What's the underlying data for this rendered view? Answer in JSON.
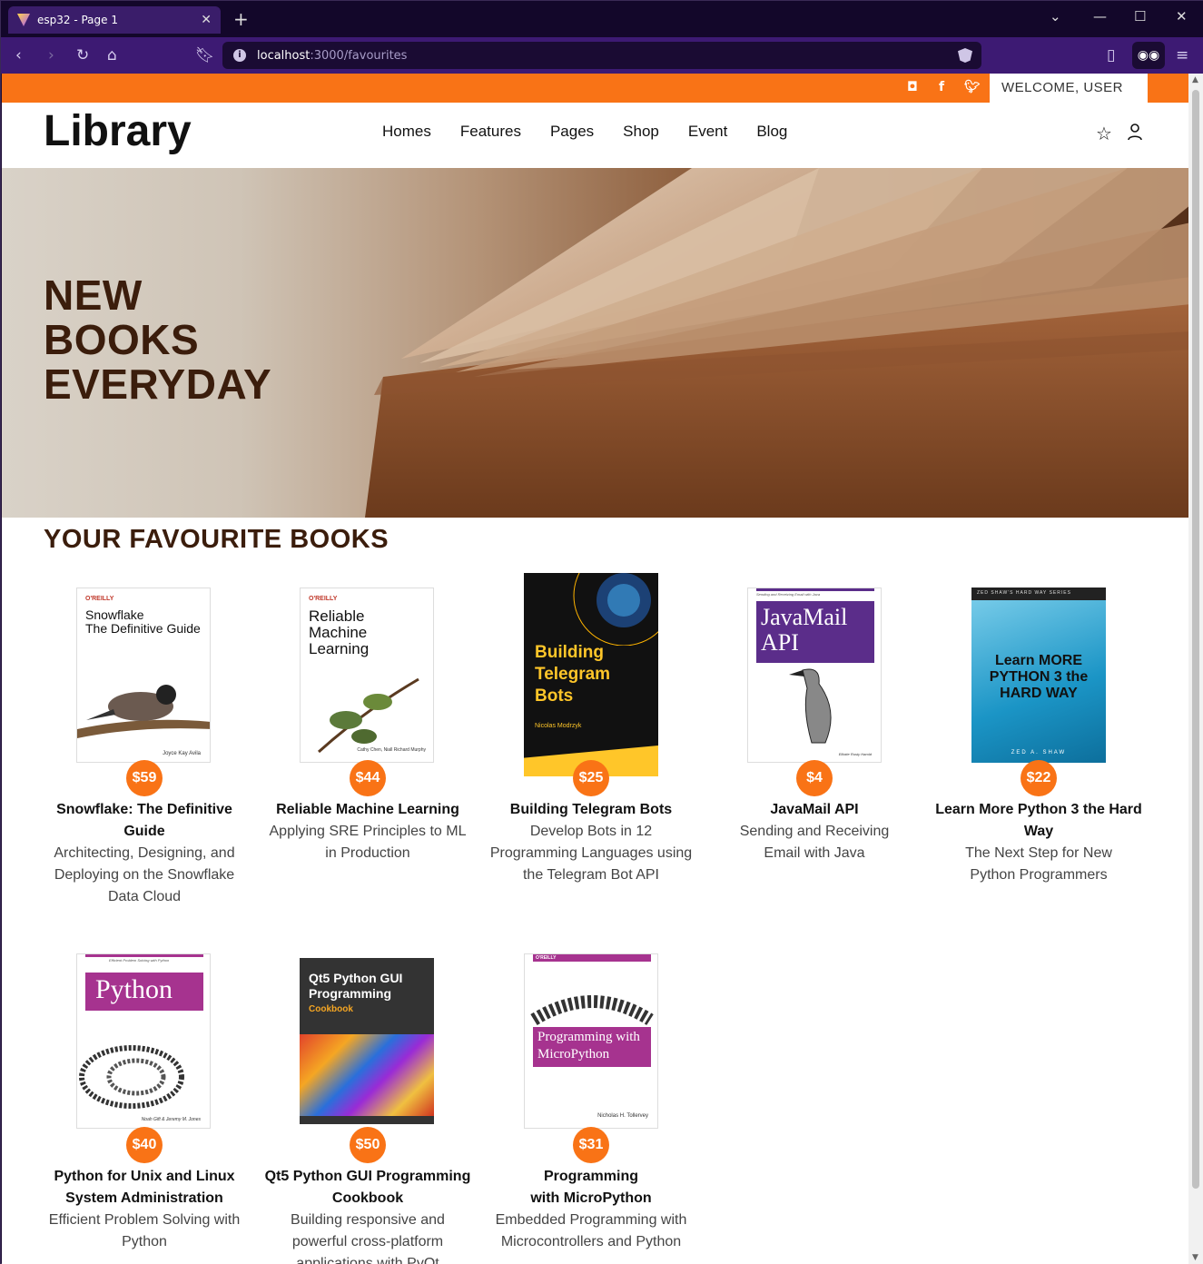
{
  "browser": {
    "tab_title": "esp32 - Page 1",
    "url_host": "localhost",
    "url_path": ":3000/favourites"
  },
  "topbar": {
    "welcome": "WELCOME, USER",
    "social": [
      "instagram-icon",
      "facebook-icon",
      "twitter-icon"
    ]
  },
  "header": {
    "logo": "Library",
    "nav": [
      "Homes",
      "Features",
      "Pages",
      "Shop",
      "Event",
      "Blog"
    ]
  },
  "hero": {
    "line1": "NEW",
    "line2": "BOOKS",
    "line3": "EVERYDAY"
  },
  "section_title": "YOUR FAVOURITE BOOKS",
  "books": [
    {
      "price": "$59",
      "title": "Snowflake: The Definitive Guide",
      "subtitle": "Architecting, Designing, and Deploying on the Snowflake Data Cloud",
      "cover_top": "O'REILLY",
      "cover_title": "Snowflake\nThe Definitive Guide",
      "cover_author": "Joyce Kay Avila"
    },
    {
      "price": "$44",
      "title": "Reliable Machine Learning",
      "subtitle": "Applying SRE Principles to ML in Production",
      "cover_top": "O'REILLY",
      "cover_title": "Reliable Machine Learning",
      "cover_author": "Cathy Chen, Niall Richard Murphy"
    },
    {
      "price": "$25",
      "title": "Building Telegram Bots",
      "subtitle": "Develop Bots in 12 Programming Languages using the Telegram Bot API",
      "cover_top": "",
      "cover_title": "Building Telegram Bots",
      "cover_author": "Nicolas Modrzyk"
    },
    {
      "price": "$4",
      "title": "JavaMail API",
      "subtitle": "Sending and Receiving Email with Java",
      "cover_top": "Sending and Receiving Email with Java",
      "cover_title": "JavaMail API",
      "cover_author": "Elliotte Rusty Harold"
    },
    {
      "price": "$22",
      "title": "Learn More Python 3 the Hard Way",
      "subtitle": "The Next Step for New Python Programmers",
      "cover_top": "ZED SHAW'S HARD WAY SERIES",
      "cover_title": "Learn MORE PYTHON 3 the HARD WAY",
      "cover_author": "ZED A. SHAW"
    },
    {
      "price": "$40",
      "title": "Python for Unix and Linux System Administration",
      "subtitle": "Efficient Problem Solving with Python",
      "cover_top": "Efficient Problem Solving with Python",
      "cover_title": "Python",
      "cover_author": "Noah Gift & Jeremy M. Jones"
    },
    {
      "price": "$50",
      "title": "Qt5 Python GUI Programming Cookbook",
      "subtitle": "Building responsive and powerful cross-platform applications with PyQt",
      "cover_top": "",
      "cover_title": "Qt5 Python GUI Programming",
      "cover_author": "Cookbook"
    },
    {
      "price": "$31",
      "title": "Programming with MicroPython",
      "subtitle": "Embedded Programming with Microcontrollers and Python",
      "cover_top": "O'REILLY",
      "cover_title": "Programming with MicroPython",
      "cover_author": "Nicholas H. Tollervey"
    }
  ],
  "colors": {
    "accent": "#f97316",
    "heading": "#3b1d0c",
    "browser": "#3d1a73"
  }
}
